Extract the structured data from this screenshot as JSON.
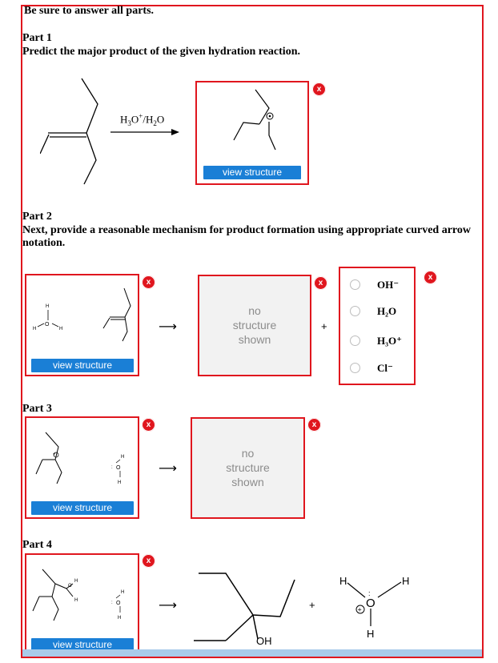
{
  "instructions": "Be sure to answer all parts.",
  "part1": {
    "title": "Part 1",
    "prompt": "Predict the major product of the given hydration reaction.",
    "reagent": "H3O+/H2O",
    "view_label": "view structure"
  },
  "part2": {
    "title": "Part 2",
    "prompt": "Next, provide a reasonable mechanism for product formation using appropriate curved arrow notation.",
    "view_label": "view structure",
    "no_structure": [
      "no",
      "structure",
      "shown"
    ],
    "plus": "+",
    "options": [
      "OH⁻",
      "H₂O",
      "H₃O⁺",
      "Cl⁻"
    ]
  },
  "part3": {
    "title": "Part 3",
    "view_label": "view structure",
    "no_structure": [
      "no",
      "structure",
      "shown"
    ]
  },
  "part4": {
    "title": "Part 4",
    "view_label": "view structure",
    "plus": "+",
    "oh_label": "OH"
  },
  "icons": {
    "close": "x",
    "arrow": "⟶"
  },
  "colors": {
    "frame": "#e0161e",
    "button": "#1a7fd6",
    "placeholder_text": "#8c8c8c"
  }
}
